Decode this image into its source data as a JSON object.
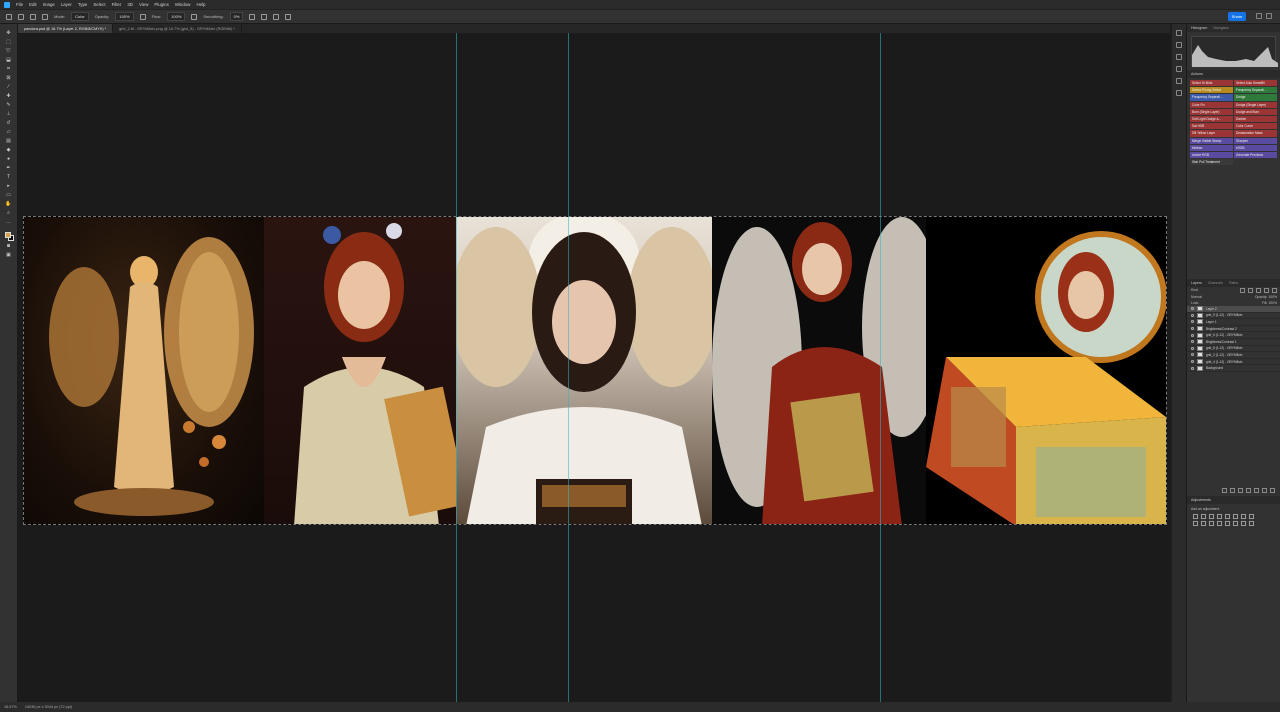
{
  "menu": [
    "File",
    "Edit",
    "Image",
    "Layer",
    "Type",
    "Select",
    "Filter",
    "3D",
    "View",
    "Plugins",
    "Window",
    "Help"
  ],
  "options": {
    "mode_label": "Mode:",
    "mode_value": "Color",
    "opacity_label": "Opacity:",
    "opacity_value": "100%",
    "flow_label": "Flow:",
    "flow_value": "100%",
    "smoothing_label": "Smoothing:",
    "smoothing_value": "0%",
    "share_label": "Share"
  },
  "tabs": [
    {
      "label": "pandora.psd @ 16.7% (Layer 2, RGB/8/CMYK) *",
      "active": true
    },
    {
      "label": "grid_2.tif - GRYM8xtx.png @ 16.7% (grid_8) - GRYM8xtx (RGB/8#) *",
      "active": false
    }
  ],
  "status": {
    "zoom": "16.67%",
    "doc_info": "14036 px x 3044 px (72 ppi)"
  },
  "panels": {
    "histogram_tab": "Histogram",
    "navigator_tab": "Navigator",
    "actions_tab": "Actions",
    "layers_tab": "Layers",
    "channels_tab": "Channels",
    "paths_tab": "Paths",
    "adjustments_tab": "Adjustments",
    "adjustments_hint": "Add an adjustment"
  },
  "actions": [
    {
      "label": "Select Hi Mids",
      "color": "#9b3434"
    },
    {
      "label": "Select Auto Smartfill",
      "color": "#9b3434"
    },
    {
      "label": "Detect Phong Select",
      "color": "#b58a1f"
    },
    {
      "label": "Frequency Separati...",
      "color": "#2f7a3a"
    },
    {
      "label": "Frequency Separati...",
      "color": "#3c5aa8"
    },
    {
      "label": "Dodge",
      "color": "#2f7a3a"
    },
    {
      "label": "Color Fix",
      "color": "#9b3434"
    },
    {
      "label": "Dodge (Single Layer)",
      "color": "#9b3434"
    },
    {
      "label": "Burn (Single Layer)",
      "color": "#9b3434"
    },
    {
      "label": "Dodge and Burn",
      "color": "#9b3434"
    },
    {
      "label": "Soft Light Dodge a...",
      "color": "#9b3434"
    },
    {
      "label": "Darken",
      "color": "#9b3434"
    },
    {
      "label": "Sat HSB",
      "color": "#9b3434"
    },
    {
      "label": "Color Curve",
      "color": "#9b3434"
    },
    {
      "label": "Sill Yellow Layer",
      "color": "#9b3434"
    },
    {
      "label": "Desaturation Mask",
      "color": "#9b3434"
    },
    {
      "label": "Merge Visible Stamp",
      "color": "#5a4aa0"
    },
    {
      "label": "Sharpen",
      "color": "#5a4aa0"
    },
    {
      "label": "Median",
      "color": "#5a4aa0"
    },
    {
      "label": "sRGB",
      "color": "#5a4aa0"
    },
    {
      "label": "Adobe RGB",
      "color": "#5a4aa0"
    },
    {
      "label": "Generate Previews",
      "color": "#5a4aa0"
    },
    {
      "label": "Skin Pull Treatment",
      "color": "#3a3a3a"
    },
    {
      "label": "",
      "color": "#323232"
    }
  ],
  "layers": {
    "kind_label": "Kind",
    "blend_mode": "Normal",
    "opacity_label": "Opacity:",
    "opacity_value": "100%",
    "lock_label": "Lock:",
    "fill_label": "Fill:",
    "fill_value": "100%",
    "items": [
      {
        "name": "Layer 2",
        "active": true
      },
      {
        "name": "grid_9 (1-12) - GRYM8xtx",
        "active": false
      },
      {
        "name": "Layer 1",
        "active": false
      },
      {
        "name": "Brightness/Contrast 2",
        "active": false
      },
      {
        "name": "grid_6 (1-12) - GRYM8xtx",
        "active": false
      },
      {
        "name": "Brightness/Contrast 1",
        "active": false
      },
      {
        "name": "grid_8 (1-12) - GRYM8xtx",
        "active": false
      },
      {
        "name": "grid_2 (1-12) - GRYM8xtx",
        "active": false
      },
      {
        "name": "grid_4 (1-12) - GRYM8xtx",
        "active": false
      },
      {
        "name": "Background",
        "active": false
      }
    ]
  }
}
